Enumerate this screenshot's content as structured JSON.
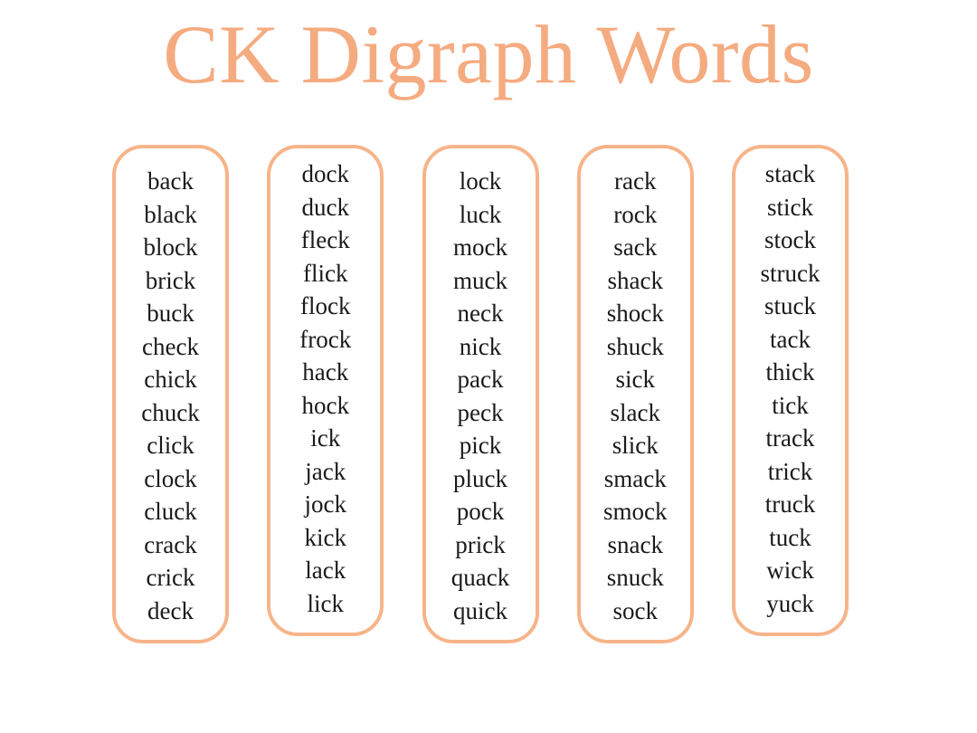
{
  "page": {
    "title": "CK Digraph Words",
    "background_color": "#ffffff",
    "title_color": "#f5ab80",
    "box_border_color": "#f7b489",
    "word_color": "#1a1a1a"
  },
  "columns": [
    {
      "id": "column-1",
      "words": [
        "back",
        "black",
        "block",
        "brick",
        "buck",
        "check",
        "chick",
        "chuck",
        "click",
        "clock",
        "cluck",
        "crack",
        "crick",
        "deck"
      ]
    },
    {
      "id": "column-2",
      "words": [
        "dock",
        "duck",
        "fleck",
        "flick",
        "flock",
        "frock",
        "hack",
        "hock",
        "ick",
        "jack",
        "jock",
        "kick",
        "lack",
        "lick"
      ]
    },
    {
      "id": "column-3",
      "words": [
        "lock",
        "luck",
        "mock",
        "muck",
        "neck",
        "nick",
        "pack",
        "peck",
        "pick",
        "pluck",
        "pock",
        "prick",
        "quack",
        "quick"
      ]
    },
    {
      "id": "column-4",
      "words": [
        "rack",
        "rock",
        "sack",
        "shack",
        "shock",
        "shuck",
        "sick",
        "slack",
        "slick",
        "smack",
        "smock",
        "snack",
        "snuck",
        "sock"
      ]
    },
    {
      "id": "column-5",
      "words": [
        "stack",
        "stick",
        "stock",
        "struck",
        "stuck",
        "tack",
        "thick",
        "tick",
        "track",
        "trick",
        "truck",
        "tuck",
        "wick",
        "yuck"
      ]
    }
  ]
}
